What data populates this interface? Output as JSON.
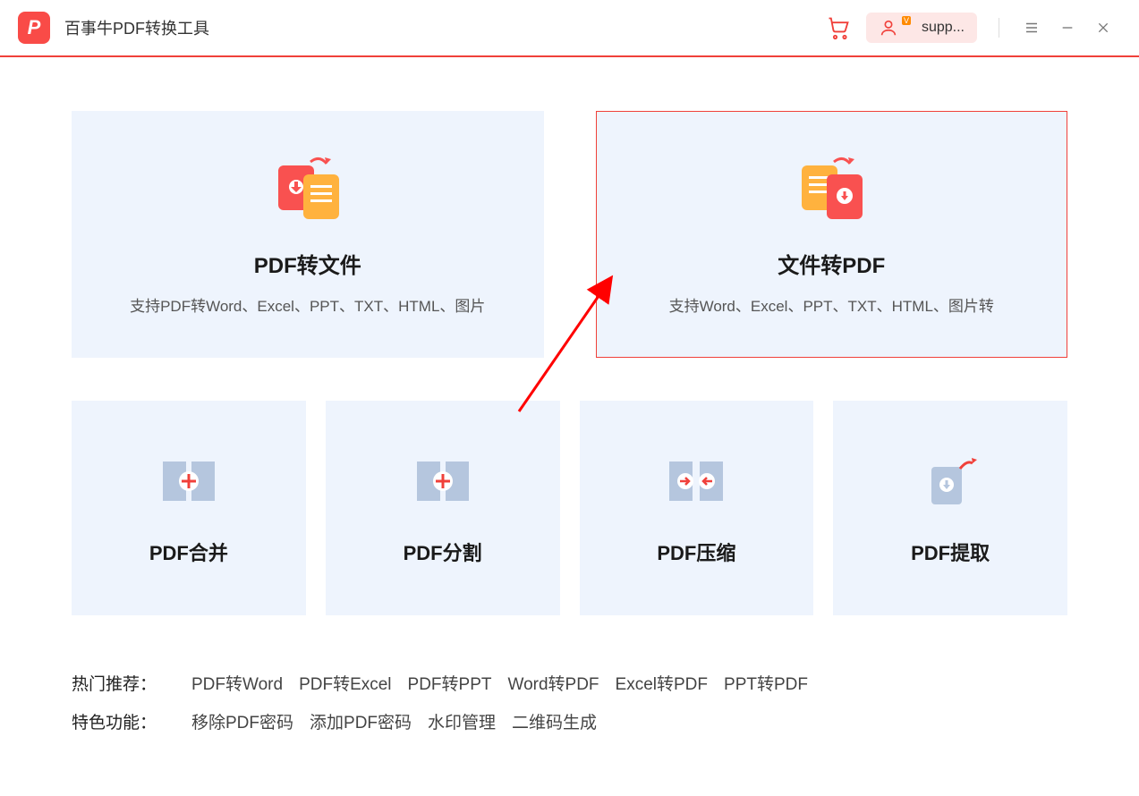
{
  "header": {
    "app_title": "百事牛PDF转换工具",
    "user_label": "supp..."
  },
  "big_cards": [
    {
      "title": "PDF转文件",
      "subtitle": "支持PDF转Word、Excel、PPT、TXT、HTML、图片",
      "selected": false
    },
    {
      "title": "文件转PDF",
      "subtitle": "支持Word、Excel、PPT、TXT、HTML、图片转",
      "selected": true
    }
  ],
  "small_cards": [
    {
      "title": "PDF合并"
    },
    {
      "title": "PDF分割"
    },
    {
      "title": "PDF压缩"
    },
    {
      "title": "PDF提取"
    }
  ],
  "recommend": {
    "label": "热门推荐：",
    "items": [
      "PDF转Word",
      "PDF转Excel",
      "PDF转PPT",
      "Word转PDF",
      "Excel转PDF",
      "PPT转PDF"
    ]
  },
  "features": {
    "label": "特色功能：",
    "items": [
      "移除PDF密码",
      "添加PDF密码",
      "水印管理",
      "二维码生成"
    ]
  }
}
